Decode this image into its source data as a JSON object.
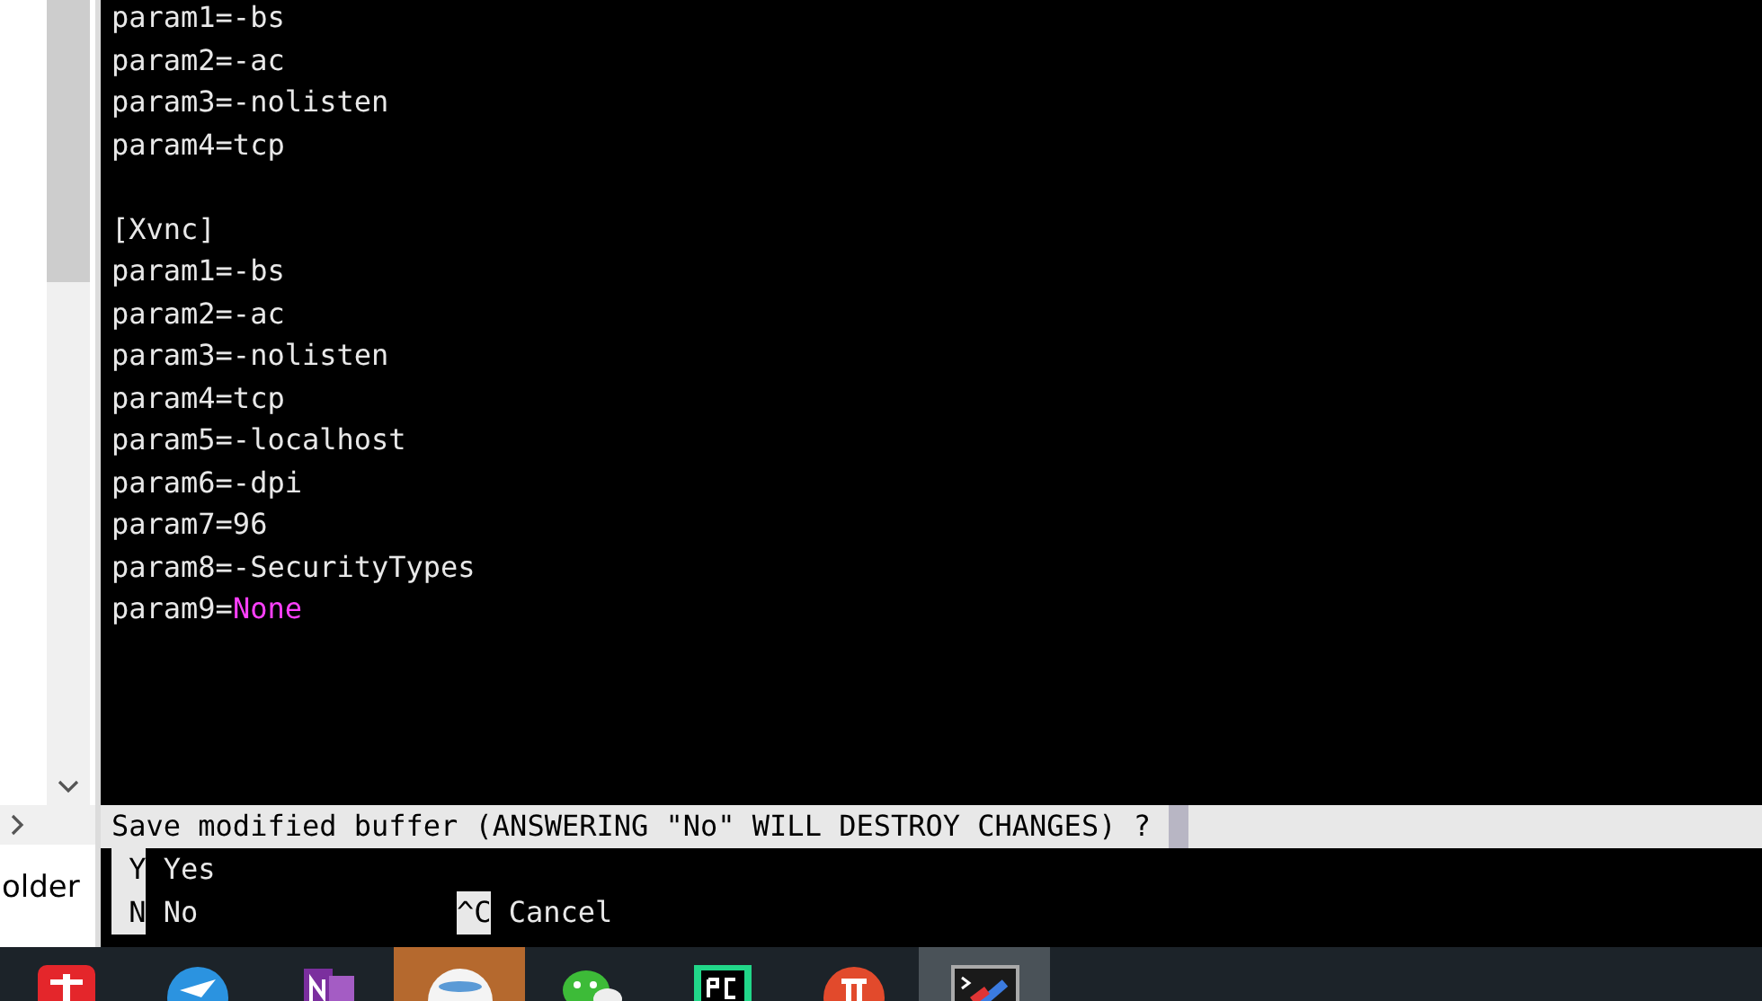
{
  "sidebar": {
    "item_label": "older"
  },
  "terminal": {
    "lines": [
      {
        "kind": "text",
        "text": "param1=-bs"
      },
      {
        "kind": "text",
        "text": "param2=-ac"
      },
      {
        "kind": "text",
        "text": "param3=-nolisten"
      },
      {
        "kind": "text",
        "text": "param4=tcp"
      },
      {
        "kind": "blank"
      },
      {
        "kind": "text",
        "text": "[Xvnc]"
      },
      {
        "kind": "text",
        "text": "param1=-bs"
      },
      {
        "kind": "text",
        "text": "param2=-ac"
      },
      {
        "kind": "text",
        "text": "param3=-nolisten"
      },
      {
        "kind": "text",
        "text": "param4=tcp"
      },
      {
        "kind": "text",
        "text": "param5=-localhost"
      },
      {
        "kind": "text",
        "text": "param6=-dpi"
      },
      {
        "kind": "text",
        "text": "param7=96"
      },
      {
        "kind": "text",
        "text": "param8=-SecurityTypes"
      },
      {
        "kind": "text",
        "text": "param9=",
        "keyword": "None"
      }
    ],
    "prompt": {
      "message": "Save modified buffer (ANSWERING \"No\" WILL DESTROY CHANGES) ?",
      "option_rows": [
        [
          {
            "key": "Y",
            "label": "Yes"
          }
        ],
        [
          {
            "key": "N",
            "label": "No"
          },
          {
            "key": "^C",
            "label": "Cancel"
          }
        ]
      ]
    }
  },
  "taskbar": {
    "apps": [
      {
        "kind": "dict",
        "selected": false
      },
      {
        "kind": "bird",
        "selected": false
      },
      {
        "kind": "note",
        "selected": false
      },
      {
        "kind": "globe",
        "selected": true
      },
      {
        "kind": "chat",
        "selected": false
      },
      {
        "kind": "ide",
        "selected": false
      },
      {
        "kind": "ring",
        "selected": false
      },
      {
        "kind": "terminal",
        "selected": true
      }
    ]
  }
}
